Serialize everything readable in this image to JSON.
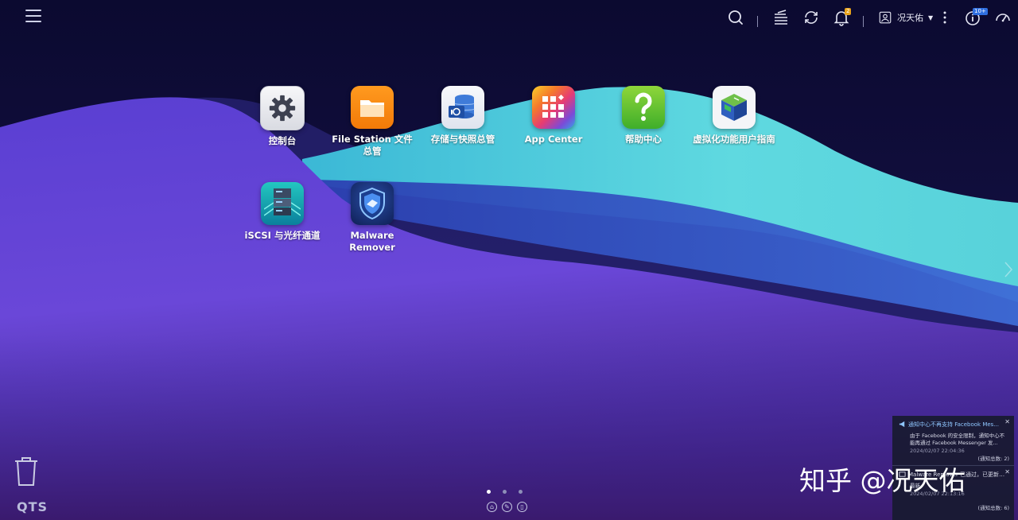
{
  "topbar": {
    "menu_icon": "hamburger-menu-icon",
    "search_icon": "search-icon",
    "tasks_icon": "background-tasks-icon",
    "sync_icon": "sync-icon",
    "notifications_icon": "bell-icon",
    "notifications_badge": "2",
    "user_name": "况天佑",
    "more_icon": "more-options-icon",
    "system_info_icon": "info-icon",
    "system_info_badge": "10+",
    "dashboard_icon": "dashboard-gauge-icon"
  },
  "apps": [
    {
      "id": "control-panel",
      "icon": "gear-icon",
      "label": "控制台"
    },
    {
      "id": "file-station",
      "icon": "folder-icon",
      "label": "File Station 文件总管"
    },
    {
      "id": "storage-snapshots",
      "icon": "storage-snapshot-icon",
      "label": "存储与快照总管"
    },
    {
      "id": "app-center",
      "icon": "app-center-icon",
      "label": "App Center"
    },
    {
      "id": "help-center",
      "icon": "question-mark-icon",
      "label": "帮助中心"
    },
    {
      "id": "virtualization-guide",
      "icon": "virtualization-cube-icon",
      "label": "虚拟化功能用户指南"
    },
    {
      "id": "iscsi-fc",
      "icon": "iscsi-server-icon",
      "label": "iSCSI 与光纤通道"
    },
    {
      "id": "malware-remover",
      "icon": "malware-shield-icon",
      "label": "Malware Remover"
    }
  ],
  "desktop": {
    "trash_icon": "trash-icon",
    "logo": "QTS",
    "pages": 3,
    "active_page": 1,
    "next_page_icon": "chevron-right-icon"
  },
  "notifications": [
    {
      "title": "通知中心不再支持 Facebook Mes...",
      "body": "由于 Facebook 的安全限制，通知中心不能再通过 Facebook Messenger 发...",
      "time": "2024/02/07 22:04:36",
      "count": "(通知总数: 2)"
    },
    {
      "title": "Malware Remover 已通过，已更新完至",
      "body": "最新。",
      "time": "2024/02/07 22:13:16",
      "count": "(通知总数: 6)"
    }
  ],
  "watermark": "知乎 @况天佑"
}
